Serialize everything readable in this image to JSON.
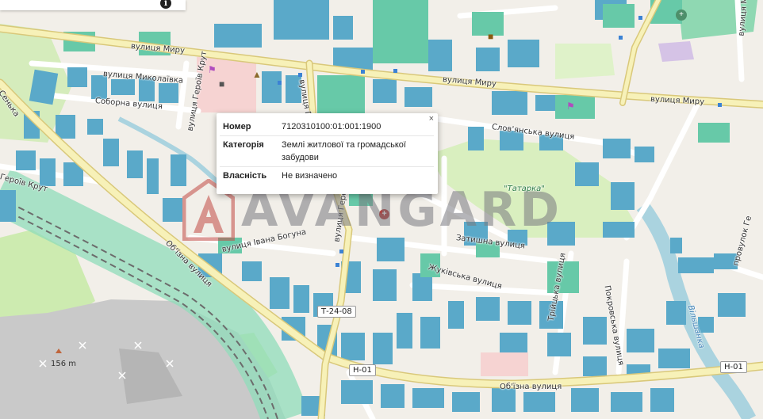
{
  "map": {
    "colors": {
      "land": "#f2efe9",
      "building": "#5aa9c9",
      "building_dark": "#3f95b8",
      "building_green": "#67c9a8",
      "park": "#cdebb0",
      "water": "#aad3df",
      "river_edge": "#93bfd0",
      "main_road": "#f7f1b8",
      "main_road_edge": "#d9c87a",
      "rail": "#8dd9b4",
      "rocks": "#bcbcbc",
      "school": "#f7d7d5"
    },
    "streets": [
      "вулиця Миру",
      "вулиця Миру",
      "вулиця Миру",
      "вулиця Миколаївка",
      "Соборна вулиця",
      "вулиця Героїв Крут",
      "вулиця Героїв Чорнобиля",
      "Героїв Крут",
      "Слов'янська вулиця",
      "Затишна вулиця",
      "Жуківська вулиця",
      "Покровська вулиця",
      "Трійцька вулиця",
      "вулиця Івана Богуна",
      "Об'їзна вулиця",
      "Об'їзна вулиця",
      "провулок Ге",
      "вулиця Мамая",
      "Вільшанка",
      "Сенька",
      "вулиця Героїв Чорнобиля"
    ],
    "park_label": "\"Татарка\"",
    "route_shields": [
      "Т-24-08",
      "Н-01",
      "Н-01"
    ],
    "elevation": "156 m",
    "icons": [
      "info-icon",
      "close-icon",
      "hospital-icon",
      "shop-icon",
      "museum-icon",
      "library-icon",
      "church-icon",
      "peak-icon",
      "mine-icon"
    ]
  },
  "popup": {
    "rows": [
      {
        "key": "Номер",
        "value": "7120310100:01:001:1900"
      },
      {
        "key": "Категорія",
        "value": "Землі житлової та громадської забудови"
      },
      {
        "key": "Власність",
        "value": "Не визначено"
      }
    ],
    "close": "×"
  },
  "watermark": "AVANGARD",
  "toolbar": {
    "info": "i"
  }
}
